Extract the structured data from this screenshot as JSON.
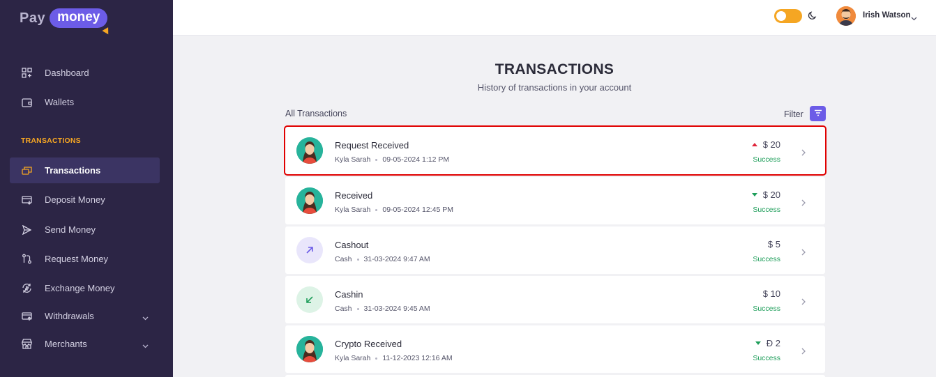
{
  "brand": {
    "pay": "Pay",
    "money": "money"
  },
  "colors": {
    "accent": "#6c5ce7",
    "sidebar": "#2c2545",
    "orange": "#f5a623",
    "success": "#1e9e5a",
    "debit": "#e0243a",
    "highlight": "#e00000"
  },
  "sidebar": {
    "items": [
      {
        "label": "Dashboard",
        "icon": "dashboard-icon"
      },
      {
        "label": "Wallets",
        "icon": "wallet-icon"
      }
    ],
    "section_label": "TRANSACTIONS",
    "tx_items": [
      {
        "label": "Transactions",
        "icon": "transactions-icon",
        "active": true
      },
      {
        "label": "Deposit Money",
        "icon": "deposit-icon"
      },
      {
        "label": "Send Money",
        "icon": "send-icon"
      },
      {
        "label": "Request Money",
        "icon": "request-icon"
      },
      {
        "label": "Exchange Money",
        "icon": "exchange-icon"
      },
      {
        "label": "Withdrawals",
        "icon": "withdrawals-icon",
        "expandable": true
      },
      {
        "label": "Merchants",
        "icon": "merchants-icon",
        "expandable": true
      }
    ]
  },
  "header": {
    "user_name": "Irish Watson",
    "theme_toggle_icon": "moon-icon"
  },
  "main": {
    "title": "TRANSACTIONS",
    "subtitle": "History of transactions in your account",
    "list_label": "All Transactions",
    "filter_label": "Filter"
  },
  "transactions": [
    {
      "title": "Request Received",
      "party": "Kyla Sarah",
      "datetime": "09-05-2024 1:12 PM",
      "amount": "$ 20",
      "direction": "up",
      "status": "Success",
      "icon": "person-avatar"
    },
    {
      "title": "Received",
      "party": "Kyla Sarah",
      "datetime": "09-05-2024 12:45 PM",
      "amount": "$ 20",
      "direction": "down",
      "status": "Success",
      "icon": "person-avatar"
    },
    {
      "title": "Cashout",
      "party": "Cash",
      "datetime": "31-03-2024 9:47 AM",
      "amount": "$ 5",
      "direction": "none",
      "status": "Success",
      "icon": "arrow-up-right-icon"
    },
    {
      "title": "Cashin",
      "party": "Cash",
      "datetime": "31-03-2024 9:45 AM",
      "amount": "$ 10",
      "direction": "none",
      "status": "Success",
      "icon": "arrow-down-left-icon"
    },
    {
      "title": "Crypto Received",
      "party": "Kyla Sarah",
      "datetime": "11-12-2023 12:16 AM",
      "amount": "Đ 2",
      "direction": "down",
      "status": "Success",
      "icon": "person-avatar"
    }
  ]
}
